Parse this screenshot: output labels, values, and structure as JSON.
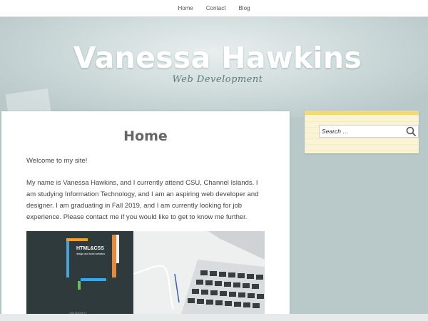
{
  "nav": {
    "items": [
      {
        "label": "Home"
      },
      {
        "label": "Contact"
      },
      {
        "label": "Blog"
      }
    ]
  },
  "header": {
    "site_title": "Vanessa Hawkins",
    "tagline": "Web Development"
  },
  "main": {
    "page_title": "Home",
    "welcome": "Welcome to my site!",
    "paragraph": "My name is Vanessa Hawkins, and I currently attend CSU, Channel Islands. I am studying Information Technology, and I am an aspiring web developer and designer. I am graduating in Fall 2019, and I am currently looking for job experience. Please contact me if you would like to get to know me further.",
    "photo": {
      "book_title": "HTML&CSS",
      "book_subtitle": "design and build websites",
      "book_author": "JON DUCKETT"
    }
  },
  "sidebar": {
    "search": {
      "placeholder": "Search …",
      "icon": "search-icon"
    }
  },
  "colors": {
    "background": "#b9c8c9",
    "title": "#ffffff",
    "tagline": "#5d7d78",
    "widget": "#fbf3d6"
  }
}
